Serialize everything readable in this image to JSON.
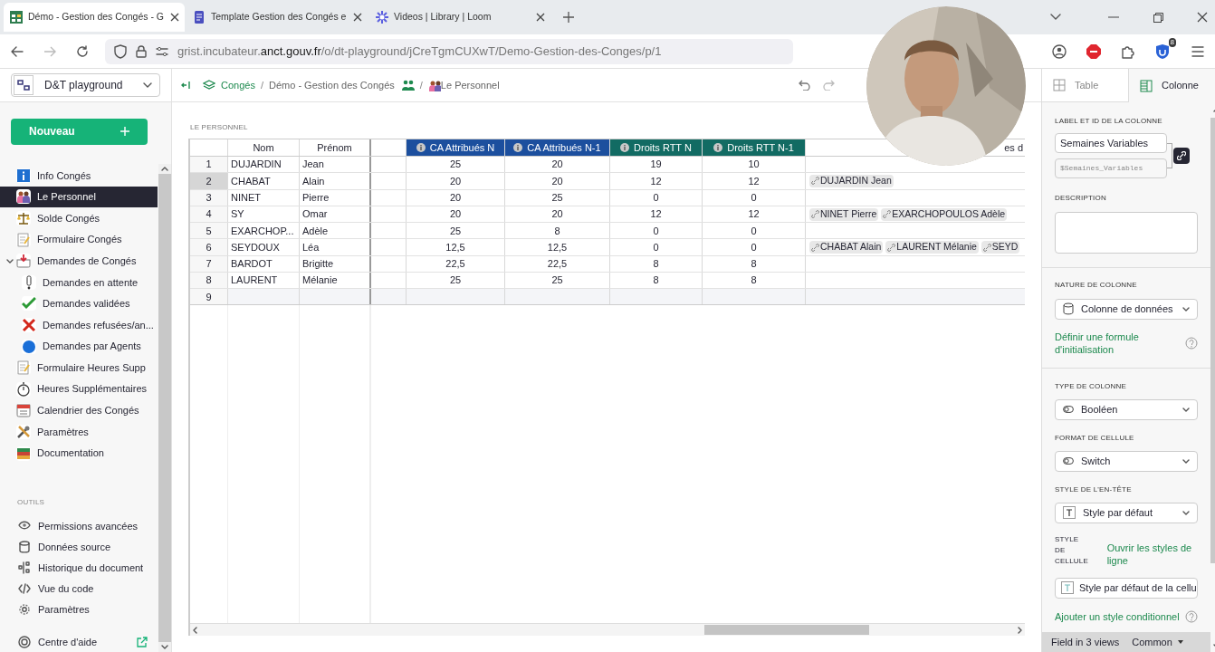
{
  "browser": {
    "tabs": [
      {
        "title": "Démo - Gestion des Congés - G",
        "kind": "grid",
        "selected": true
      },
      {
        "title": "Template Gestion des Congés e",
        "kind": "doc",
        "selected": false
      },
      {
        "title": "Videos | Library | Loom",
        "kind": "loom",
        "selected": false
      }
    ],
    "url_prefix": "grist.incubateur.",
    "url_domain": "anct.gouv.fr",
    "url_path": "/o/dt-playground/jCreTgmCUXwT/Demo-Gestion-des-Conges/p/1",
    "extension_badge": "8"
  },
  "sidebar": {
    "org": "D&T playground",
    "new_button": "Nouveau",
    "pages": [
      {
        "label": "Info Congés",
        "kind": "info",
        "selected": false
      },
      {
        "label": "Le Personnel",
        "kind": "people",
        "selected": true
      },
      {
        "label": "Solde Congés",
        "kind": "scale",
        "selected": false
      },
      {
        "label": "Formulaire Congés",
        "kind": "form",
        "selected": false
      },
      {
        "label": "Demandes de Congés",
        "kind": "inbox",
        "selected": false,
        "expanded": true,
        "children": [
          {
            "label": "Demandes en attente",
            "kind": "exclaim",
            "selected": false
          },
          {
            "label": "Demandes validées",
            "kind": "check",
            "selected": false
          },
          {
            "label": "Demandes refusées/an...",
            "kind": "cross",
            "selected": false
          },
          {
            "label": "Demandes par Agents",
            "kind": "circle",
            "selected": false
          }
        ]
      },
      {
        "label": "Formulaire Heures Supp",
        "kind": "form",
        "selected": false
      },
      {
        "label": "Heures Supplémentaires",
        "kind": "timer",
        "selected": false
      },
      {
        "label": "Calendrier des Congés",
        "kind": "calendar",
        "selected": false
      },
      {
        "label": "Paramètres",
        "kind": "tools",
        "selected": false
      },
      {
        "label": "Documentation",
        "kind": "books",
        "selected": false
      }
    ],
    "tools_heading": "OUTILS",
    "tools": [
      {
        "label": "Permissions avancées",
        "kind": "eye"
      },
      {
        "label": "Données source",
        "kind": "database"
      },
      {
        "label": "Historique du document",
        "kind": "history"
      },
      {
        "label": "Vue du code",
        "kind": "code"
      },
      {
        "label": "Paramètres",
        "kind": "gear"
      }
    ],
    "help": "Centre d'aide"
  },
  "breadcrumb": {
    "workspace": "Congés",
    "separators": [
      "/",
      "/"
    ],
    "document": "Démo - Gestion des Congés",
    "page": "Le Personnel"
  },
  "section_title": "LE PERSONNEL",
  "table": {
    "columns": [
      {
        "label": "Nom"
      },
      {
        "label": "Prénom"
      },
      {
        "label": "CA Attribués N",
        "color": "#1c4f9e"
      },
      {
        "label": "CA Attribués N-1",
        "color": "#1c4f9e"
      },
      {
        "label": "Droits RTT N",
        "color": "#126b63"
      },
      {
        "label": "Droits RTT N-1",
        "color": "#126b63"
      },
      {
        "label": "es d"
      }
    ],
    "rows": [
      {
        "number": "1",
        "nom": "DUJARDIN",
        "prenom": "Jean",
        "values": [
          "25",
          "20",
          "19",
          "10"
        ],
        "refs": [],
        "selected": false
      },
      {
        "number": "2",
        "nom": "CHABAT",
        "prenom": "Alain",
        "values": [
          "20",
          "20",
          "12",
          "12"
        ],
        "refs": [
          "DUJARDIN Jean"
        ],
        "selected": true
      },
      {
        "number": "3",
        "nom": "NINET",
        "prenom": "Pierre",
        "values": [
          "20",
          "25",
          "0",
          "0"
        ],
        "refs": [],
        "selected": false
      },
      {
        "number": "4",
        "nom": "SY",
        "prenom": "Omar",
        "values": [
          "20",
          "20",
          "12",
          "12"
        ],
        "refs": [
          "NINET Pierre",
          "EXARCHOPOULOS Adèle"
        ],
        "selected": false
      },
      {
        "number": "5",
        "nom": "EXARCHOP...",
        "prenom": "Adèle",
        "values": [
          "25",
          "8",
          "0",
          "0"
        ],
        "refs": [],
        "selected": false
      },
      {
        "number": "6",
        "nom": "SEYDOUX",
        "prenom": "Léa",
        "values": [
          "12,5",
          "12,5",
          "0",
          "0"
        ],
        "refs": [
          "CHABAT Alain",
          "LAURENT Mélanie",
          "SEYD"
        ],
        "selected": false
      },
      {
        "number": "7",
        "nom": "BARDOT",
        "prenom": "Brigitte",
        "values": [
          "22,5",
          "22,5",
          "8",
          "8"
        ],
        "refs": [],
        "selected": false
      },
      {
        "number": "8",
        "nom": "LAURENT",
        "prenom": "Mélanie",
        "values": [
          "25",
          "25",
          "8",
          "8"
        ],
        "refs": [],
        "selected": false
      }
    ],
    "new_row_number": "9"
  },
  "panel": {
    "tabs": [
      {
        "label": "Table",
        "selected": false
      },
      {
        "label": "Colonne",
        "selected": true
      }
    ],
    "label_heading": "LABEL ET ID DE LA COLONNE",
    "label_value": "Semaines Variables",
    "id_value": "$Semaines_Variables",
    "description_heading": "DESCRIPTION",
    "nature_heading": "NATURE DE COLONNE",
    "nature_value": "Colonne de données",
    "formula_link": "Définir une formule d'initialisation",
    "type_heading": "TYPE DE COLONNE",
    "type_value": "Booléen",
    "format_heading": "FORMAT DE CELLULE",
    "format_value": "Switch",
    "header_style_heading": "STYLE DE L'EN-TÊTE",
    "header_style_value": "Style par défaut",
    "cell_style_heading": "STYLE DE CELLULE",
    "row_styles_link": "Ouvrir les styles de ligne",
    "cell_style_value": "Style par défaut de la cellu",
    "conditional_link": "Ajouter un style conditionnel",
    "footer_views": "Field in 3 views",
    "footer_mode": "Common"
  }
}
